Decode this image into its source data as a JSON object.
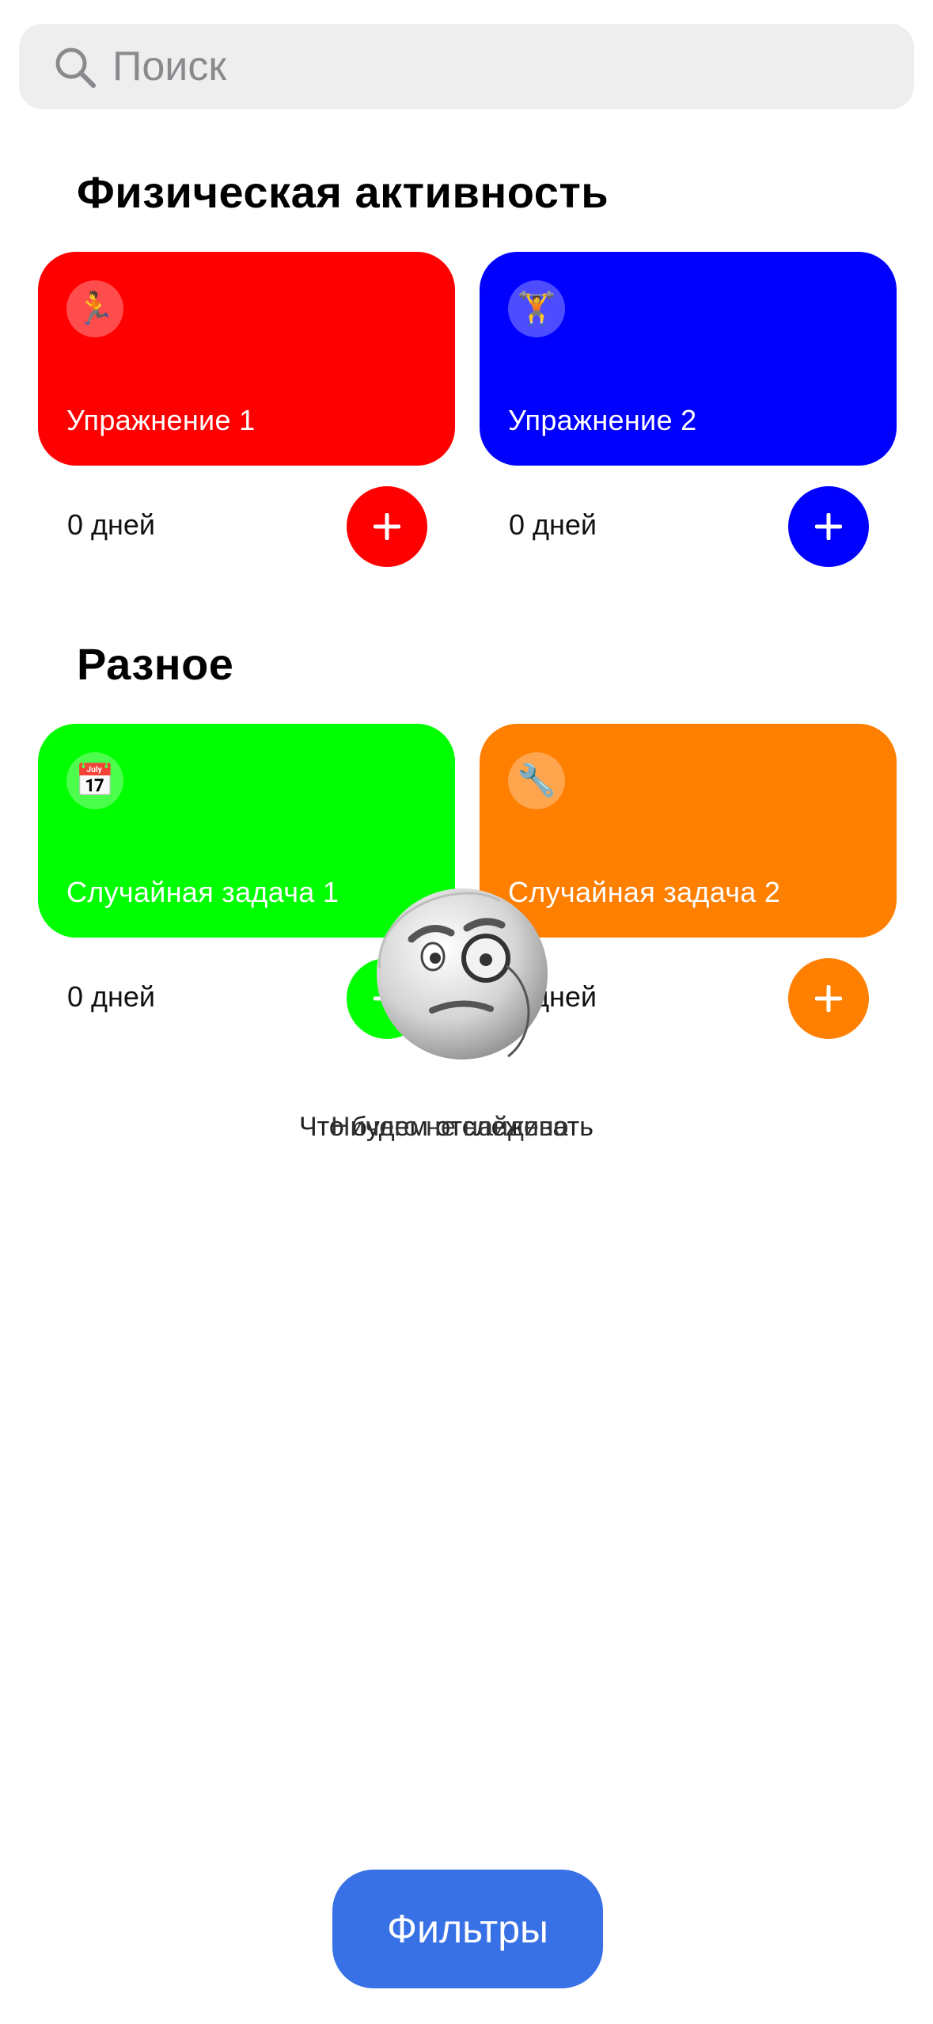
{
  "search": {
    "placeholder": "Поиск"
  },
  "sections": [
    {
      "title": "Физическая активность",
      "cards": [
        {
          "title": "Упражнение 1",
          "emoji": "🏃",
          "icon": "runner-icon",
          "color": "#ff0000",
          "days": "0 дней"
        },
        {
          "title": "Упражнение 2",
          "emoji": "🏋",
          "icon": "weightlifter-icon",
          "color": "#0000ff",
          "days": "0 дней"
        }
      ]
    },
    {
      "title": "Разное",
      "cards": [
        {
          "title": "Случайная задача 1",
          "emoji": "📅",
          "icon": "calendar-icon",
          "color": "#00ff00",
          "days": "0 дней"
        },
        {
          "title": "Случайная задача 2",
          "emoji": "🔧",
          "icon": "wrench-icon",
          "color": "#ff7f00",
          "days": "0 дней"
        }
      ]
    }
  ],
  "empty_state": {
    "icon": "face-with-monocle-icon",
    "text_a": "Что будем отслеживать",
    "text_b": "Ничего не найдено"
  },
  "filters_button": {
    "label": "Фильтры",
    "color": "#3871e6"
  }
}
